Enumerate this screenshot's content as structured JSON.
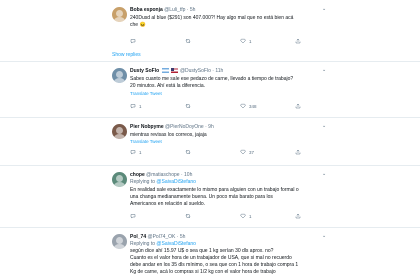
{
  "show_replies": "Show replies",
  "translate": "Translate Tweet",
  "tweets": [
    {
      "name": "Boba esponja",
      "handle": "@Luli_tfp",
      "time": "5h",
      "avatar_color": "#c8a06a",
      "reply_to": "",
      "text_lines": [
        "240Dusd al blue ($291) son 407.000?! Hay algo mal que no está bien acá",
        "che 😖"
      ],
      "replies": "",
      "retweets": "",
      "likes": "1"
    },
    {
      "name": "Dusty SoFlo",
      "handle": "@DustySoFlo",
      "time": "11h",
      "avatar_color": "#6f8fa8",
      "reply_to": "",
      "text_lines": [
        "Sabes cuanto me sale ese pedazo de carne, llevado a tiempo de trabajo?",
        "20 minutos. Ahí está la diferencia."
      ],
      "replies": "1",
      "retweets": "",
      "likes": "348"
    },
    {
      "name": "Pier Nobpyme",
      "handle": "@PierNoDoyOne",
      "time": "9h",
      "avatar_color": "#7a5a4a",
      "reply_to": "",
      "text_lines": [
        "mientras revisas los correos, jajaja"
      ],
      "replies": "1",
      "retweets": "",
      "likes": "37"
    },
    {
      "name": "chope",
      "handle": "@matiaschope",
      "time": "10h",
      "avatar_color": "#5b8a7a",
      "reply_to": "@SaivaDiStefano",
      "text_lines": [
        "En realidad sale exactamente lo mismo para alguien con un trabajo formal o",
        "una changa medianamente buena. Un poco más barato para los",
        "Americanos en relación al sueldo."
      ],
      "replies": "",
      "retweets": "",
      "likes": "1"
    },
    {
      "name": "Pol_74",
      "handle": "@Pol74_OK",
      "time": "5h",
      "avatar_color": "#9aa3ad",
      "reply_to": "@SaivaDiStefano",
      "text_lines": [
        "según dice ahí 15.97 U$ o sea que 1 kg serían 30 dls aprox. no?",
        "Cuanto es el valor hora de un trabajador de USA, que si mal no recuerdo",
        "debe andar en los 35 dls mínimo, o sea que con 1 hora de trabajo compra 1",
        "Kg de carne, acá lo compras si 1/2 kg con el valor hora de trabajo"
      ],
      "replies": "",
      "retweets": "",
      "likes": ""
    }
  ]
}
